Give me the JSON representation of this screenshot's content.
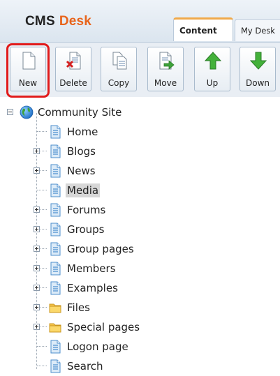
{
  "header": {
    "logo_cms": "CMS",
    "logo_desk": "Desk",
    "tabs": [
      {
        "label": "Content",
        "active": true
      },
      {
        "label": "My Desk",
        "active": false
      }
    ]
  },
  "toolbar": {
    "buttons": [
      {
        "label": "New",
        "icon": "new-page-icon"
      },
      {
        "label": "Delete",
        "icon": "delete-page-icon"
      },
      {
        "label": "Copy",
        "icon": "copy-page-icon"
      },
      {
        "label": "Move",
        "icon": "move-page-icon"
      },
      {
        "label": "Up",
        "icon": "arrow-up-icon"
      },
      {
        "label": "Down",
        "icon": "arrow-down-icon"
      }
    ],
    "highlighted": "New"
  },
  "tree": {
    "root": {
      "label": "Community Site",
      "icon": "globe-icon"
    },
    "items": [
      {
        "label": "Home",
        "icon": "page-icon",
        "expandable": false
      },
      {
        "label": "Blogs",
        "icon": "page-icon",
        "expandable": true
      },
      {
        "label": "News",
        "icon": "page-icon",
        "expandable": true
      },
      {
        "label": "Media",
        "icon": "page-icon",
        "expandable": false,
        "selected": true
      },
      {
        "label": "Forums",
        "icon": "page-icon",
        "expandable": true
      },
      {
        "label": "Groups",
        "icon": "page-icon",
        "expandable": true
      },
      {
        "label": "Group pages",
        "icon": "page-icon",
        "expandable": true
      },
      {
        "label": "Members",
        "icon": "page-icon",
        "expandable": true
      },
      {
        "label": "Examples",
        "icon": "page-icon",
        "expandable": true
      },
      {
        "label": "Files",
        "icon": "folder-icon",
        "expandable": true
      },
      {
        "label": "Special pages",
        "icon": "folder-icon",
        "expandable": true
      },
      {
        "label": "Logon page",
        "icon": "page-icon",
        "expandable": false
      },
      {
        "label": "Search",
        "icon": "page-icon",
        "expandable": false
      }
    ]
  },
  "colors": {
    "accent": "#e8641b",
    "highlight": "#e11b1b",
    "selection": "#d7d7d7"
  }
}
